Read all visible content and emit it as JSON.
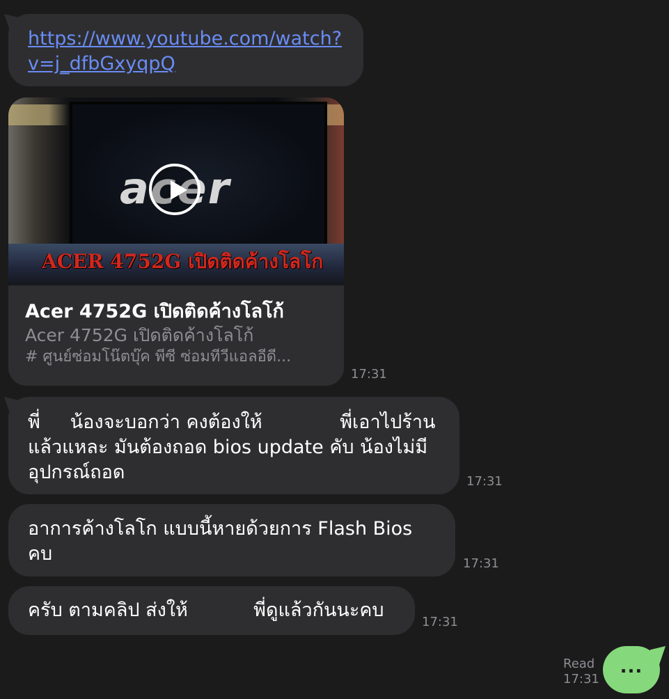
{
  "messages": {
    "link": {
      "url_text": "https://www.youtube.com/watch?v=j_dfbGxyqpQ"
    },
    "preview": {
      "thumbnail_logo": "acer",
      "thumbnail_caption": "ACER 4752G เปิดติดค้างโลโก",
      "title": "Acer 4752G เปิดติดค้างโลโก้",
      "subtitle": "Acer 4752G เปิดติดค้างโลโก้",
      "description": "# ศูนย์ซ่อมโน๊ตบุ๊ค พีซี ซ่อมทีวีแอลอีดี...",
      "time": "17:31"
    },
    "msg1": {
      "text": "พี่     น้องจะบอกว่า คงต้องให้             พี่เอาไปร้าน\nแล้วแหละ มันต้องถอด bios update คับ น้องไม่มี\nอุปกรณ์ถอด",
      "time": "17:31"
    },
    "msg2": {
      "text": "อาการค้างโลโก แบบนี้หายด้วยการ Flash Bios\nคบ",
      "time": "17:31"
    },
    "msg3": {
      "text": "ครับ ตามคลิป ส่งให้           พี่ดูแล้วกันนะคบ",
      "time": "17:31"
    },
    "sent": {
      "text": "...",
      "read_label": "Read",
      "time": "17:31"
    }
  },
  "colors": {
    "background": "#1b1b1c",
    "incoming_bubble": "#2e2e30",
    "outgoing_bubble": "#86d87c",
    "link": "#6a8cf5",
    "meta_text": "#8e8e93"
  },
  "icons": {
    "play": "play-icon"
  }
}
